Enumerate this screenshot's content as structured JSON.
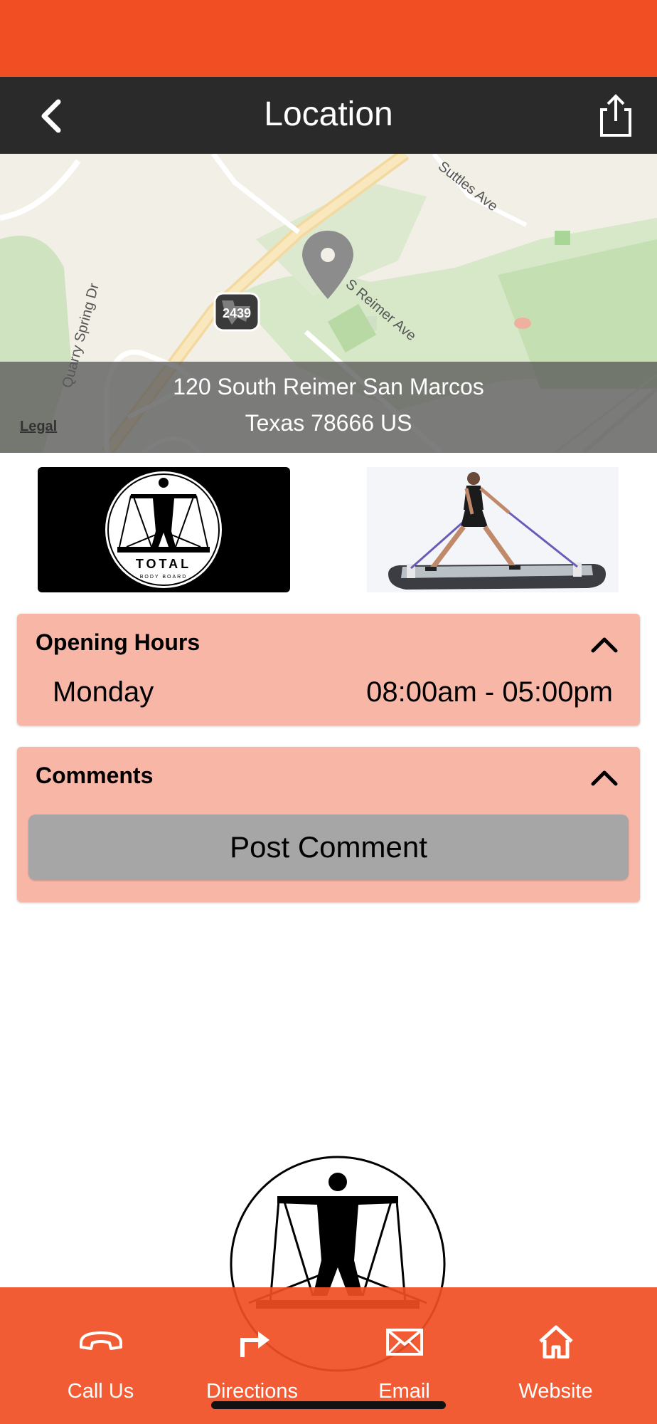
{
  "header": {
    "title": "Location"
  },
  "map": {
    "address_line1": "120 South Reimer San Marcos",
    "address_line2": "Texas 78666 US",
    "legal_label": "Legal",
    "streets": [
      "Suttles Ave",
      "S Reimer Ave",
      "Quarry Spring Dr"
    ],
    "shield_number": "2439"
  },
  "gallery": {
    "logo_word": "TOTAL",
    "logo_sub": "BODY BOARD"
  },
  "opening_hours": {
    "title": "Opening Hours",
    "rows": [
      {
        "day": "Monday",
        "time": "08:00am - 05:00pm"
      }
    ]
  },
  "comments": {
    "title": "Comments",
    "post_label": "Post Comment"
  },
  "tabbar": {
    "items": [
      {
        "label": "Call Us",
        "icon": "phone-icon"
      },
      {
        "label": "Directions",
        "icon": "directions-icon"
      },
      {
        "label": "Email",
        "icon": "envelope-icon"
      },
      {
        "label": "Website",
        "icon": "home-icon"
      }
    ]
  },
  "colors": {
    "accent": "#f24e23",
    "nav": "#2a2a2a",
    "card": "#f7b6a6",
    "button": "#a6a6a6"
  }
}
